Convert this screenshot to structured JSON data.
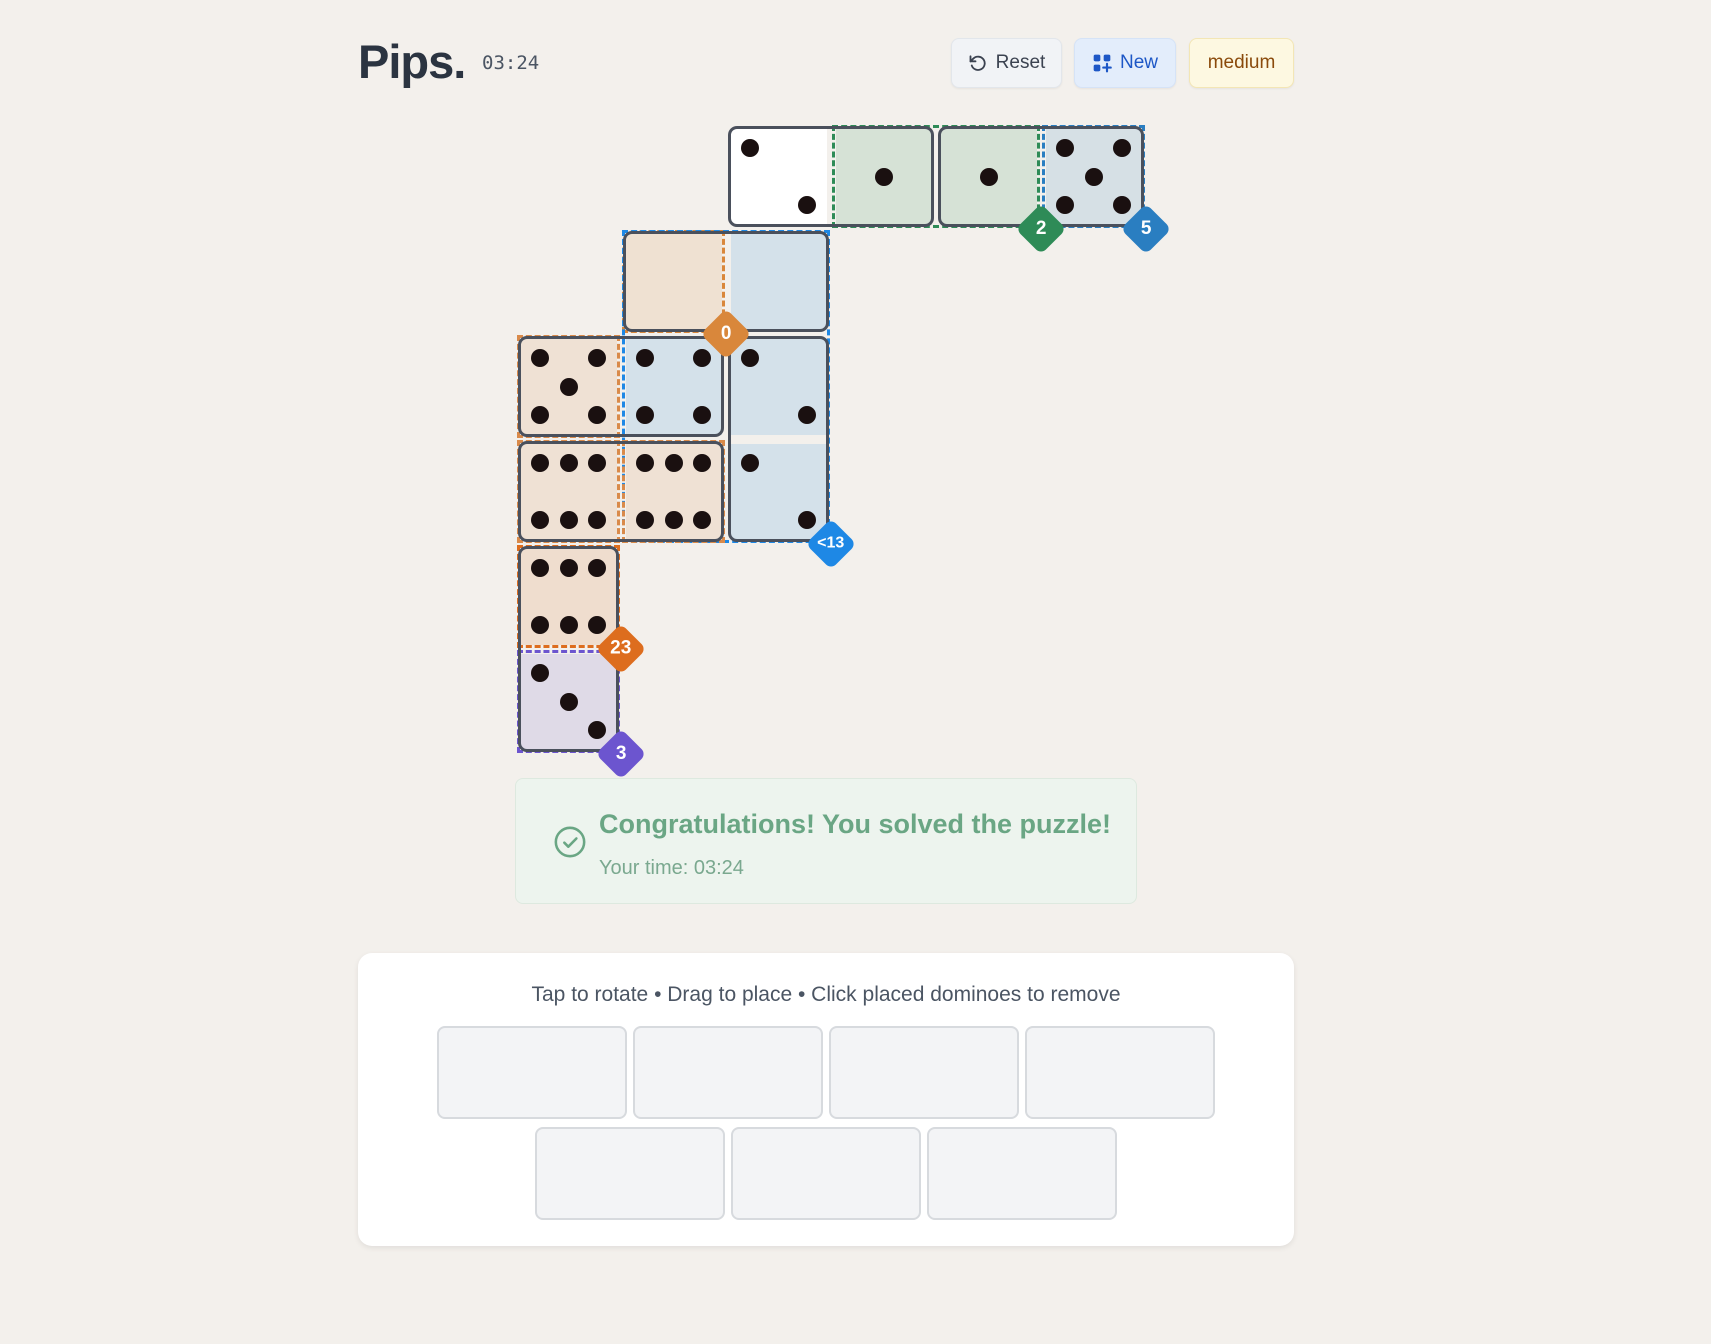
{
  "header": {
    "title": "Pips.",
    "timer": "03:24",
    "reset_label": "Reset",
    "new_label": "New",
    "difficulty_label": "medium"
  },
  "regions": [
    {
      "id": "empty-white",
      "type": "none",
      "color": "#ffffff"
    },
    {
      "id": "green-2",
      "type": "equal",
      "label": "2",
      "color": "#2e8b57"
    },
    {
      "id": "blue-5",
      "type": "sum",
      "label": "5",
      "color": "#2a7ec1"
    },
    {
      "id": "orange-0",
      "type": "sum",
      "label": "0",
      "color": "#d9873b"
    },
    {
      "id": "blue-lt13",
      "type": "less",
      "label": "<13",
      "color": "#1e88e5"
    },
    {
      "id": "orange-23",
      "type": "sum",
      "label": "23",
      "color": "#dd6d1e"
    },
    {
      "id": "purple-3",
      "type": "sum",
      "label": "3",
      "color": "#6c55cf"
    },
    {
      "id": "orange-big",
      "type": "equal",
      "label": "",
      "color": "#d98a4a"
    }
  ],
  "cells": [
    {
      "row": 0,
      "col": 2,
      "pips": 2,
      "region": "empty-white"
    },
    {
      "row": 0,
      "col": 3,
      "pips": 1,
      "region": "green-2"
    },
    {
      "row": 0,
      "col": 4,
      "pips": 1,
      "region": "green-2"
    },
    {
      "row": 0,
      "col": 5,
      "pips": 5,
      "region": "blue-5"
    },
    {
      "row": 1,
      "col": 1,
      "pips": 0,
      "region": "orange-0"
    },
    {
      "row": 1,
      "col": 2,
      "pips": 0,
      "region": "blue-lt13"
    },
    {
      "row": 2,
      "col": 0,
      "pips": 5,
      "region": "orange-big"
    },
    {
      "row": 2,
      "col": 1,
      "pips": 4,
      "region": "blue-lt13"
    },
    {
      "row": 2,
      "col": 2,
      "pips": 2,
      "region": "blue-lt13"
    },
    {
      "row": 3,
      "col": 0,
      "pips": 6,
      "region": "orange-big"
    },
    {
      "row": 3,
      "col": 1,
      "pips": 6,
      "region": "orange-big"
    },
    {
      "row": 3,
      "col": 2,
      "pips": 2,
      "region": "blue-lt13"
    },
    {
      "row": 4,
      "col": 0,
      "pips": 6,
      "region": "orange-23"
    },
    {
      "row": 5,
      "col": 0,
      "pips": 3,
      "region": "purple-3"
    }
  ],
  "dominoes": [
    {
      "a": [
        0,
        2
      ],
      "b": [
        0,
        3
      ]
    },
    {
      "a": [
        0,
        4
      ],
      "b": [
        0,
        5
      ]
    },
    {
      "a": [
        1,
        1
      ],
      "b": [
        1,
        2
      ]
    },
    {
      "a": [
        2,
        0
      ],
      "b": [
        2,
        1
      ]
    },
    {
      "a": [
        2,
        2
      ],
      "b": [
        3,
        2
      ]
    },
    {
      "a": [
        3,
        0
      ],
      "b": [
        3,
        1
      ]
    },
    {
      "a": [
        4,
        0
      ],
      "b": [
        5,
        0
      ]
    }
  ],
  "banner": {
    "message": "Congratulations! You solved the puzzle!",
    "time_text": "Your time: 03:24"
  },
  "tray": {
    "hint": "Tap to rotate • Drag to place • Click placed dominoes to remove",
    "slot_count": 7
  },
  "icons": {
    "reset": "rotate-ccw-icon",
    "new": "grid-plus-icon",
    "success": "check-circle-icon"
  }
}
